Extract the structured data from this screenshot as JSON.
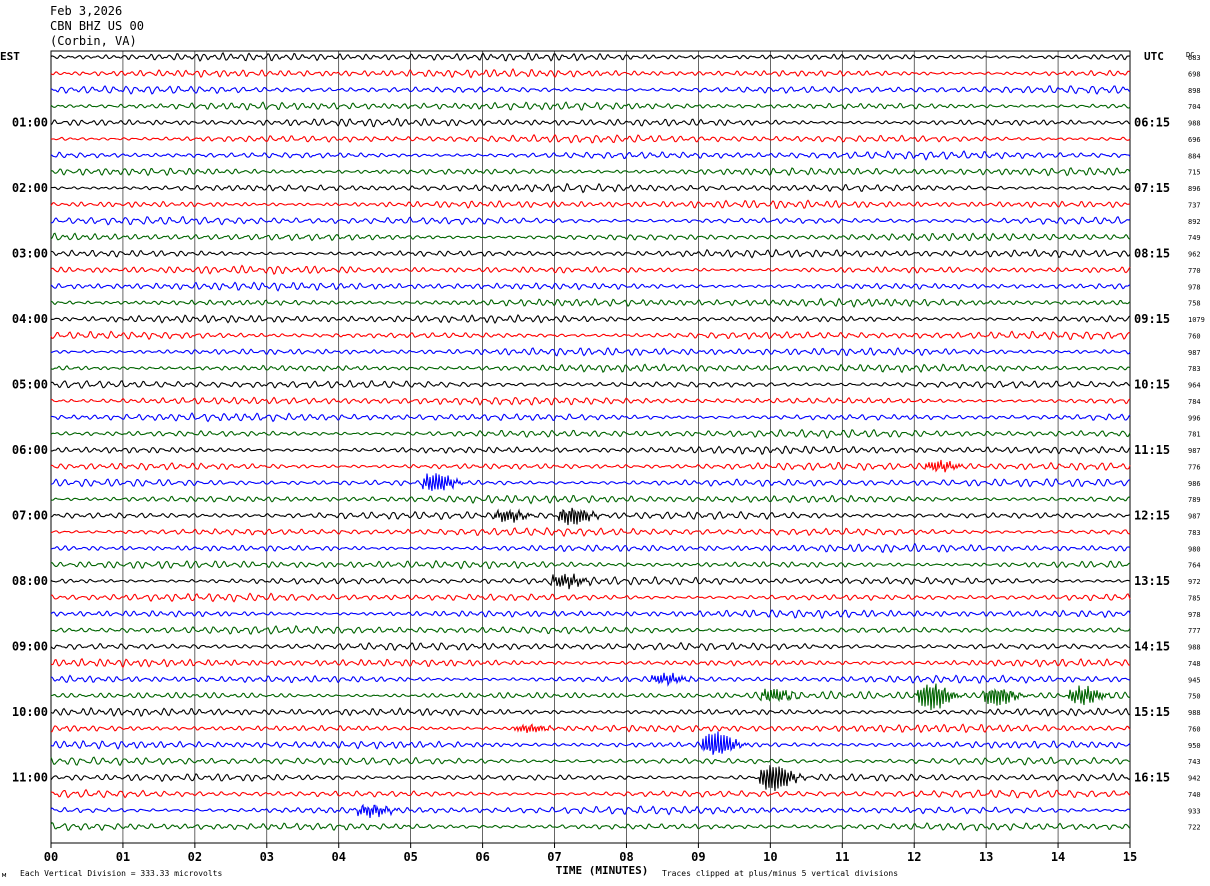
{
  "header": {
    "date": "Feb 3,2026",
    "station": "CBN BHZ US 00",
    "location": "(Corbin, VA)"
  },
  "left_label": "EST",
  "right_label": "UTC",
  "dc_label": "DC",
  "footer": {
    "scale_note": "Each Vertical Division =  333.33 microvolts",
    "xlabel": "TIME (MINUTES)",
    "clip_note": "Traces clipped at plus/minus 5 vertical divisions"
  },
  "colors": {
    "black": "#000000",
    "red": "#ff0000",
    "blue": "#0000ff",
    "green": "#006400",
    "grid": "#000000"
  },
  "chart_data": {
    "type": "line",
    "title": "CBN BHZ US 00 (Corbin, VA) Feb 3,2026",
    "xlabel": "TIME (MINUTES)",
    "xlim": [
      0,
      15
    ],
    "x_ticks": [
      "00",
      "01",
      "02",
      "03",
      "04",
      "05",
      "06",
      "07",
      "08",
      "09",
      "10",
      "11",
      "12",
      "13",
      "14",
      "15"
    ],
    "est_hours": [
      "01:00",
      "02:00",
      "03:00",
      "04:00",
      "05:00",
      "06:00",
      "07:00",
      "08:00",
      "09:00",
      "10:00",
      "11:00"
    ],
    "utc_hours": [
      "06:15",
      "07:15",
      "08:15",
      "09:15",
      "10:15",
      "11:15",
      "12:15",
      "13:15",
      "14:15",
      "15:15",
      "16:15"
    ],
    "trace_colors": [
      "black",
      "red",
      "blue",
      "green"
    ],
    "dc_offsets": [
      683,
      698,
      898,
      704,
      988,
      696,
      884,
      715,
      896,
      737,
      892,
      749,
      962,
      770,
      978,
      758,
      1079,
      760,
      987,
      783,
      964,
      784,
      996,
      781,
      987,
      776,
      986,
      789,
      987,
      783,
      980,
      764,
      972,
      785,
      978,
      777,
      988,
      748,
      945,
      750,
      988,
      760,
      950,
      743,
      942,
      740,
      933,
      722
    ],
    "events": [
      {
        "trace": 26,
        "minute": 5.2,
        "amp": 1.5
      },
      {
        "trace": 28,
        "minute": 7.1,
        "amp": 1.4
      },
      {
        "trace": 28,
        "minute": 6.2,
        "amp": 0.9
      },
      {
        "trace": 32,
        "minute": 7.0,
        "amp": 1.0
      },
      {
        "trace": 38,
        "minute": 8.4,
        "amp": 0.8
      },
      {
        "trace": 39,
        "minute": 12.1,
        "amp": 2.2
      },
      {
        "trace": 39,
        "minute": 13.0,
        "amp": 1.5
      },
      {
        "trace": 39,
        "minute": 14.2,
        "amp": 1.4
      },
      {
        "trace": 39,
        "minute": 9.9,
        "amp": 1.0
      },
      {
        "trace": 42,
        "minute": 9.1,
        "amp": 2.0
      },
      {
        "trace": 44,
        "minute": 9.9,
        "amp": 2.2
      },
      {
        "trace": 46,
        "minute": 4.3,
        "amp": 0.9
      },
      {
        "trace": 41,
        "minute": 6.5,
        "amp": 0.6
      },
      {
        "trace": 25,
        "minute": 12.2,
        "amp": 0.8
      }
    ]
  }
}
